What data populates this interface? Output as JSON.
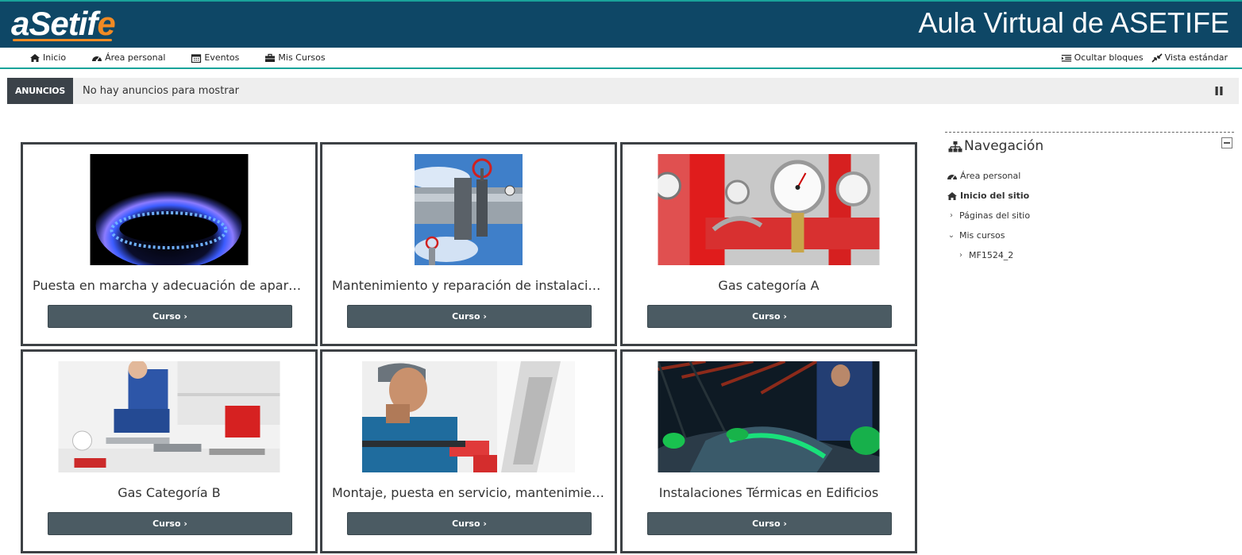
{
  "header": {
    "logo_main": "aSetif",
    "logo_accent": "e",
    "title": "Aula Virtual de ASETIFE"
  },
  "navbar": {
    "items": [
      {
        "label": "Inicio",
        "icon": "home-icon"
      },
      {
        "label": "Área personal",
        "icon": "dashboard-icon"
      },
      {
        "label": "Eventos",
        "icon": "calendar-icon"
      },
      {
        "label": "Mis Cursos",
        "icon": "briefcase-icon"
      }
    ],
    "right_items": [
      {
        "label": "Ocultar bloques",
        "icon": "indent-icon"
      },
      {
        "label": "Vista estándar",
        "icon": "compress-icon"
      }
    ]
  },
  "announcements": {
    "label": "ANUNCIOS",
    "text": "No hay anuncios para mostrar"
  },
  "courses": [
    {
      "title": "Puesta en marcha y adecuación de aparatos a gas",
      "button": "Curso ›",
      "image": "gas-flame-image"
    },
    {
      "title": "Mantenimiento y reparación de instalaciones receptoras",
      "button": "Curso ›",
      "image": "pipeline-valve-image"
    },
    {
      "title": "Gas categoría A",
      "button": "Curso ›",
      "image": "pressure-gauges-image"
    },
    {
      "title": "Gas Categoría B",
      "button": "Curso ›",
      "image": "plumber-image"
    },
    {
      "title": "Montaje, puesta en servicio, mantenimiento, inspección",
      "button": "Curso ›",
      "image": "technician-image"
    },
    {
      "title": "Instalaciones Térmicas en Edificios",
      "button": "Curso ›",
      "image": "insulation-image"
    }
  ],
  "navigation": {
    "title": "Navegación",
    "items": [
      {
        "label": "Área personal"
      },
      {
        "label": "Inicio del sitio"
      },
      {
        "label": "Páginas del sitio"
      },
      {
        "label": "Mis cursos"
      },
      {
        "label": "MF1524_2"
      }
    ]
  },
  "colors": {
    "header_bg": "#0e4766",
    "accent_teal": "#19a39a",
    "logo_orange": "#f08a24",
    "button_bg": "#4b5b63"
  }
}
